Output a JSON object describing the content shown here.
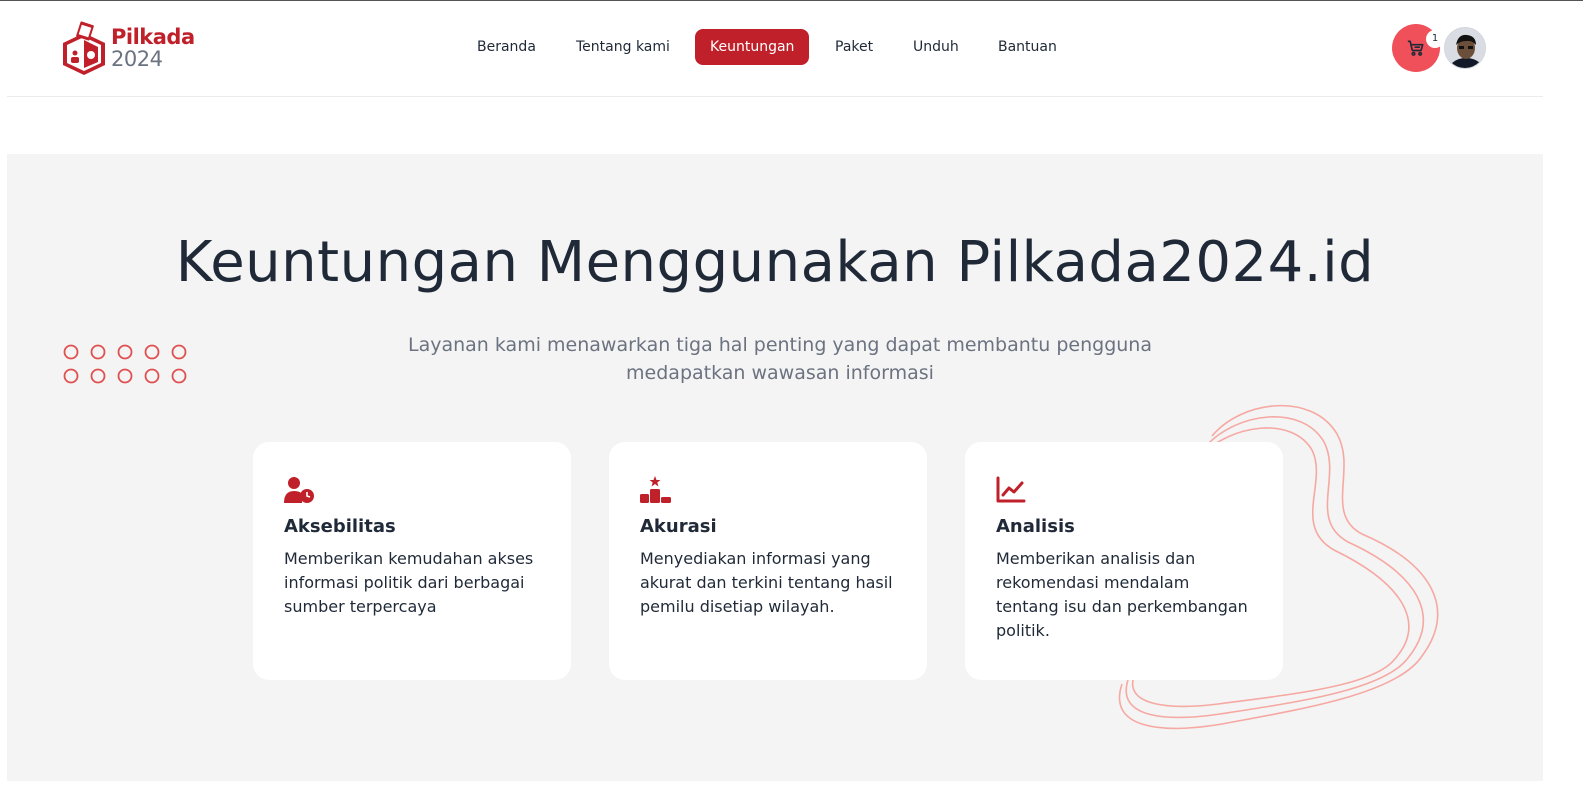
{
  "brand": {
    "name_line1": "Pilkada",
    "name_line2": "2024",
    "primary_color": "#c0202a",
    "accent_color": "#f0505a"
  },
  "nav": {
    "items": [
      {
        "label": "Beranda",
        "active": false
      },
      {
        "label": "Tentang kami",
        "active": false
      },
      {
        "label": "Keuntungan",
        "active": true
      },
      {
        "label": "Paket",
        "active": false
      },
      {
        "label": "Unduh",
        "active": false
      },
      {
        "label": "Bantuan",
        "active": false
      }
    ]
  },
  "header_actions": {
    "cart_icon": "cart-icon",
    "cart_count": "1",
    "avatar_icon": "user-avatar"
  },
  "hero": {
    "title": "Keuntungan Menggunakan Pilkada2024.id",
    "subtitle": "Layanan kami menawarkan tiga hal penting yang dapat membantu pengguna medapatkan wawasan informasi"
  },
  "features": [
    {
      "icon": "user-clock-icon",
      "title": "Aksebilitas",
      "text": "Memberikan kemudahan akses informasi politik dari berbagai sumber terpercaya"
    },
    {
      "icon": "ranking-podium-icon",
      "title": "Akurasi",
      "text": "Menyediakan informasi yang akurat dan terkini tentang hasil pemilu disetiap wilayah."
    },
    {
      "icon": "line-chart-icon",
      "title": "Analisis",
      "text": "Memberikan analisis dan rekomendasi mendalam tentang isu dan perkembangan politik."
    }
  ]
}
